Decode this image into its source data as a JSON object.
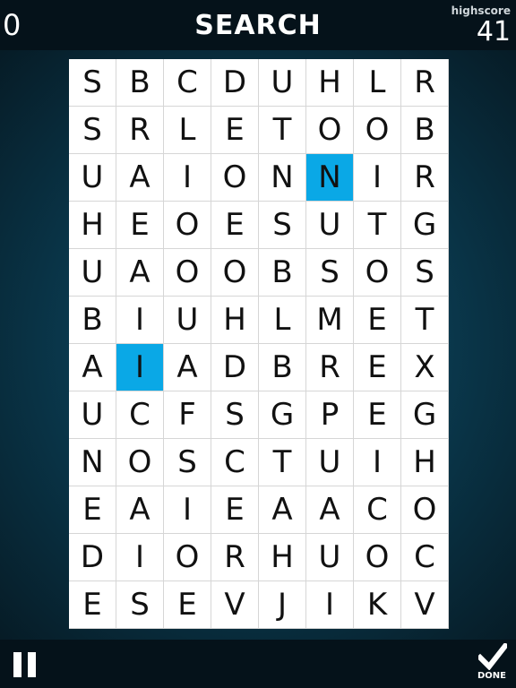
{
  "header": {
    "score": "0",
    "title": "SEARCH",
    "highscore_label": "highscore",
    "highscore_value": "41"
  },
  "grid": {
    "rows": [
      [
        "S",
        "B",
        "C",
        "D",
        "U",
        "H",
        "L",
        "R"
      ],
      [
        "S",
        "R",
        "L",
        "E",
        "T",
        "O",
        "O",
        "B"
      ],
      [
        "U",
        "A",
        "I",
        "O",
        "N",
        "N",
        "I",
        "R"
      ],
      [
        "H",
        "E",
        "O",
        "E",
        "S",
        "U",
        "T",
        "G"
      ],
      [
        "U",
        "A",
        "O",
        "O",
        "B",
        "S",
        "O",
        "S"
      ],
      [
        "B",
        "I",
        "U",
        "H",
        "L",
        "M",
        "E",
        "T"
      ],
      [
        "A",
        "I",
        "A",
        "D",
        "B",
        "R",
        "E",
        "X"
      ],
      [
        "U",
        "C",
        "F",
        "S",
        "G",
        "P",
        "E",
        "G"
      ],
      [
        "N",
        "O",
        "S",
        "C",
        "T",
        "U",
        "I",
        "H"
      ],
      [
        "E",
        "A",
        "I",
        "E",
        "A",
        "A",
        "C",
        "O"
      ],
      [
        "D",
        "I",
        "O",
        "R",
        "H",
        "U",
        "O",
        "C"
      ],
      [
        "E",
        "S",
        "E",
        "V",
        "J",
        "I",
        "K",
        "V"
      ]
    ],
    "selected_cells": [
      [
        2,
        5
      ],
      [
        6,
        1
      ]
    ],
    "highlight_color": "#0aa8e6"
  },
  "footer": {
    "pause_icon": "pause-icon",
    "done_icon": "check-icon",
    "done_label": "DONE"
  }
}
